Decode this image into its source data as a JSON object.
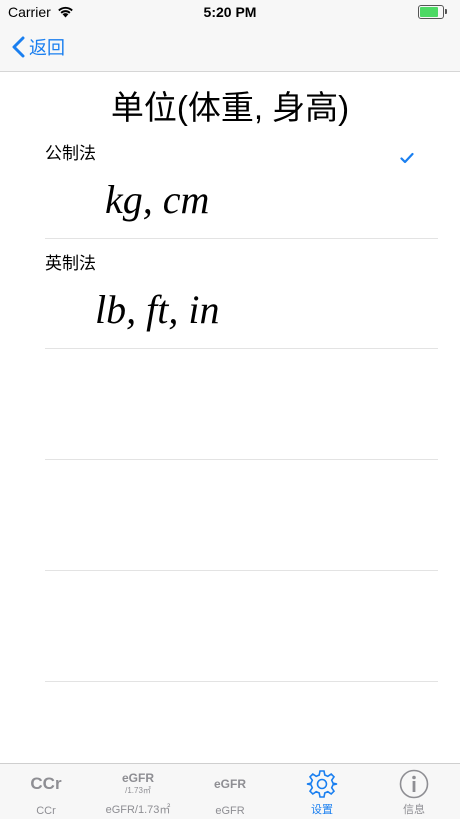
{
  "status": {
    "carrier": "Carrier",
    "time": "5:20 PM",
    "battery_level": 0.9
  },
  "nav": {
    "back_label": "返回",
    "back_icon": "chevron-left-icon"
  },
  "page": {
    "title": "单位(体重, 身高)"
  },
  "options": [
    {
      "section": "公制法",
      "units": "kg, cm",
      "selected": true
    },
    {
      "section": "英制法",
      "units": "lb, ft, in",
      "selected": false
    }
  ],
  "tabs": [
    {
      "label": "CCr",
      "icon_text": "CCr"
    },
    {
      "label": "eGFR/1.73㎡",
      "icon_text": "eGFR",
      "icon_sub": "/1.73㎡"
    },
    {
      "label": "eGFR",
      "icon_text": "eGFR"
    },
    {
      "label": "设置",
      "icon": "gear-icon",
      "active": true
    },
    {
      "label": "信息",
      "icon": "info-icon"
    }
  ],
  "colors": {
    "accent": "#1a7ff0",
    "inactive": "#8e8e93"
  }
}
